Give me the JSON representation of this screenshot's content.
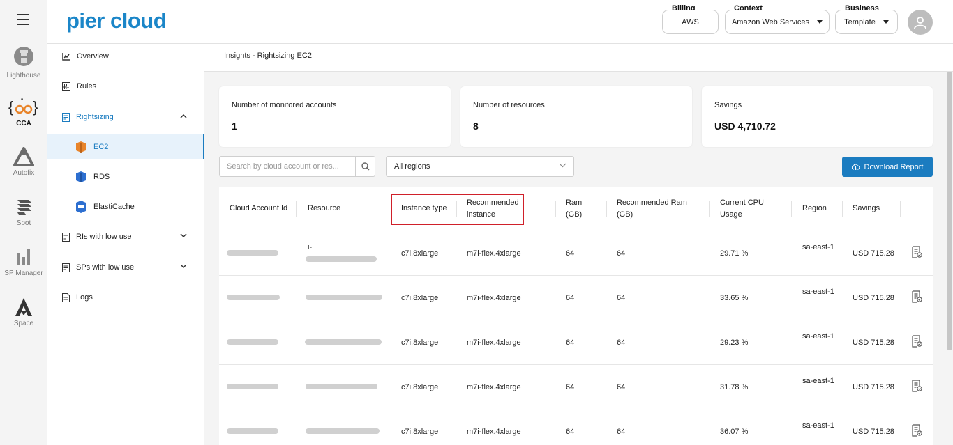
{
  "rail": {
    "items": [
      {
        "label": "Lighthouse",
        "icon": "lighthouse-icon"
      },
      {
        "label": "CCA",
        "icon": "cca-icon"
      },
      {
        "label": "Autofix",
        "icon": "autofix-icon"
      },
      {
        "label": "Spot",
        "icon": "spot-icon"
      },
      {
        "label": "SP Manager",
        "icon": "sp-manager-icon"
      },
      {
        "label": "Space",
        "icon": "space-icon"
      }
    ]
  },
  "logo": "pier cloud",
  "nav": {
    "overview": "Overview",
    "rules": "Rules",
    "rightsizing": "Rightsizing",
    "ec2": "EC2",
    "rds": "RDS",
    "elasticache": "ElastiCache",
    "ris_low_use": "RIs with low use",
    "sps_low_use": "SPs with low use",
    "logs": "Logs"
  },
  "header": {
    "billing": {
      "label": "Billing",
      "value": "AWS"
    },
    "context": {
      "label": "Context",
      "value": "Amazon Web Services"
    },
    "business": {
      "label": "Business",
      "value": "Template"
    }
  },
  "breadcrumb": "Insights - Rightsizing EC2",
  "cards": [
    {
      "label": "Number of monitored accounts",
      "value": "1"
    },
    {
      "label": "Number of resources",
      "value": "8"
    },
    {
      "label": "Savings",
      "value": "USD 4,710.72"
    }
  ],
  "search": {
    "placeholder": "Search by cloud account or res..."
  },
  "region_filter": "All regions",
  "download_label": "Download Report",
  "table": {
    "headers": {
      "cloud_account": "Cloud Account Id",
      "resource": "Resource",
      "instance_type": "Instance type",
      "recommended_instance": "Recommended instance",
      "ram": "Ram (GB)",
      "recommended_ram": "Recommended Ram (GB)",
      "cpu": "Current CPU Usage",
      "region": "Region",
      "savings": "Savings"
    },
    "rows": [
      {
        "resource_prefix": "i-",
        "instance_type": "c7i.8xlarge",
        "recommended": "m7i-flex.4xlarge",
        "ram": "64",
        "rec_ram": "64",
        "cpu": "29.71 %",
        "region": "sa-east-1",
        "savings": "USD 715.28"
      },
      {
        "resource_prefix": "",
        "instance_type": "c7i.8xlarge",
        "recommended": "m7i-flex.4xlarge",
        "ram": "64",
        "rec_ram": "64",
        "cpu": "33.65 %",
        "region": "sa-east-1",
        "savings": "USD 715.28"
      },
      {
        "resource_prefix": "",
        "instance_type": "c7i.8xlarge",
        "recommended": "m7i-flex.4xlarge",
        "ram": "64",
        "rec_ram": "64",
        "cpu": "29.23 %",
        "region": "sa-east-1",
        "savings": "USD 715.28"
      },
      {
        "resource_prefix": "",
        "instance_type": "c7i.8xlarge",
        "recommended": "m7i-flex.4xlarge",
        "ram": "64",
        "rec_ram": "64",
        "cpu": "31.78 %",
        "region": "sa-east-1",
        "savings": "USD 715.28"
      },
      {
        "resource_prefix": "",
        "instance_type": "c7i.8xlarge",
        "recommended": "m7i-flex.4xlarge",
        "ram": "64",
        "rec_ram": "64",
        "cpu": "36.07 %",
        "region": "sa-east-1",
        "savings": "USD 715.28"
      }
    ]
  },
  "colors": {
    "brand": "#1b86c8",
    "accent": "#1b7cc0",
    "highlight": "#d0202a"
  }
}
